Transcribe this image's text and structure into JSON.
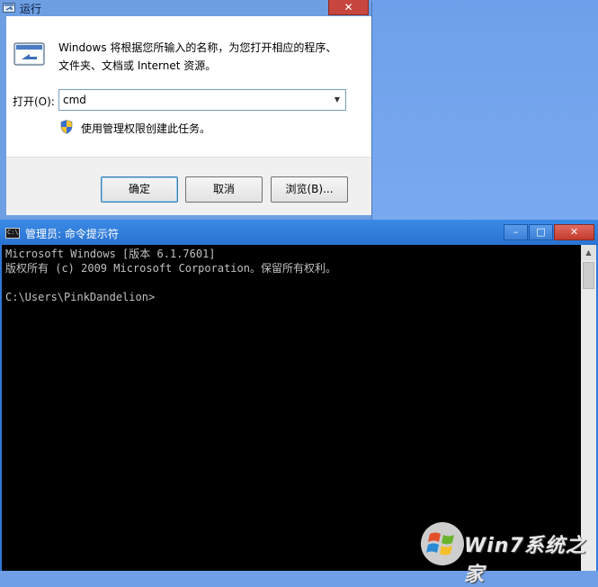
{
  "run_dialog": {
    "title": "运行",
    "close_glyph": "✕",
    "description_line1": "Windows 将根据您所输入的名称，为您打开相应的程序、",
    "description_line2": "文件夹、文档或 Internet 资源。",
    "open_label": "打开(O):",
    "open_value": "cmd",
    "admin_note": "使用管理权限创建此任务。",
    "buttons": {
      "ok": "确定",
      "cancel": "取消",
      "browse": "浏览(B)..."
    }
  },
  "cmd_window": {
    "title": "管理员: 命令提示符",
    "icon_text": "C:\\",
    "controls": {
      "minimize": "–",
      "maximize": "□",
      "close": "✕"
    },
    "lines": [
      "Microsoft Windows [版本 6.1.7601]",
      "版权所有 (c) 2009 Microsoft Corporation。保留所有权利。",
      "",
      "C:\\Users\\PinkDandelion>"
    ]
  },
  "watermark": {
    "text": "Win7系统之家"
  },
  "icons": {
    "run_title": "run-icon",
    "run_big": "run-program-icon",
    "shield": "uac-shield-icon",
    "cmd": "cmd-icon",
    "windows_logo": "windows-logo-icon"
  },
  "colors": {
    "desktop": "#6f9fe6",
    "cmd_titlebar": "#2d7ad8",
    "console_bg": "#000000",
    "console_text": "#c0c0c0",
    "close_red": "#c7463d"
  }
}
